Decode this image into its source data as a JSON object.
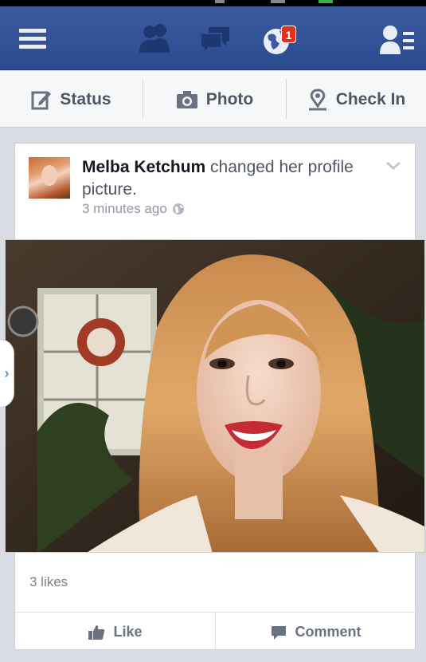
{
  "topbar": {
    "menu_icon": "hamburger-menu-icon",
    "friends_icon": "friend-requests-icon",
    "messages_icon": "messages-icon",
    "notifications_icon": "globe-notifications-icon",
    "notifications_count": "1",
    "profile_icon": "profile-list-icon",
    "bar_color": "#2f4f94",
    "badge_color": "#e0301e"
  },
  "composer": {
    "status_label": "Status",
    "photo_label": "Photo",
    "checkin_label": "Check In"
  },
  "post": {
    "author": "Melba Ketchum",
    "action_text": " changed her profile picture.",
    "timestamp": "3 minutes ago",
    "privacy_icon": "globe-public-icon",
    "likes": "3 likes",
    "like_label": "Like",
    "comment_label": "Comment"
  }
}
